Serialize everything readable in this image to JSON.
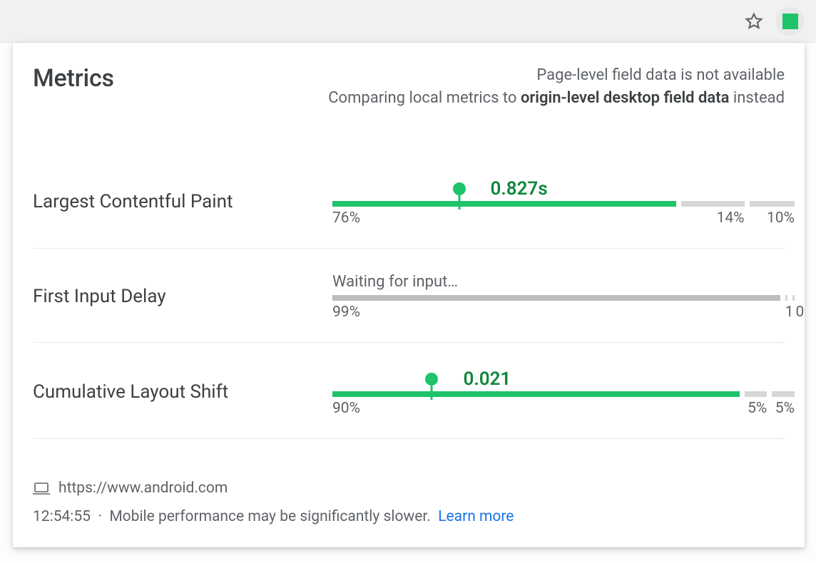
{
  "header": {
    "title": "Metrics",
    "availability_line1": "Page-level field data is not available",
    "availability_line2a": "Comparing local metrics to ",
    "availability_line2_bold": "origin-level desktop field data",
    "availability_line2b": " instead"
  },
  "metrics": {
    "lcp": {
      "name": "Largest Contentful Paint",
      "value": "0.827s",
      "status": "good",
      "marker_pct": 28,
      "dist": {
        "good": 76,
        "ni": 14,
        "poor": 10
      },
      "good_label": "76%",
      "ni_label": "14%",
      "poor_label": "10%"
    },
    "fid": {
      "name": "First Input Delay",
      "waiting": "Waiting for input…",
      "dist": {
        "good": 99,
        "ni": 0.5,
        "poor": 0.5
      },
      "good_label": "99%",
      "ni_label": "1",
      "poor_label": "0"
    },
    "cls": {
      "name": "Cumulative Layout Shift",
      "value": "0.021",
      "status": "good",
      "marker_pct": 22,
      "dist": {
        "good": 90,
        "ni": 5,
        "poor": 5
      },
      "good_label": "90%",
      "ni_label": "5%",
      "poor_label": "5%"
    }
  },
  "footer": {
    "url": "https://www.android.com",
    "time": "12:54:55",
    "sep": "·",
    "note": "Mobile performance may be significantly slower.",
    "learn": "Learn more"
  },
  "colors": {
    "good": "#1ec36a",
    "good_text": "#10873d",
    "muted": "#d6d6d6"
  }
}
